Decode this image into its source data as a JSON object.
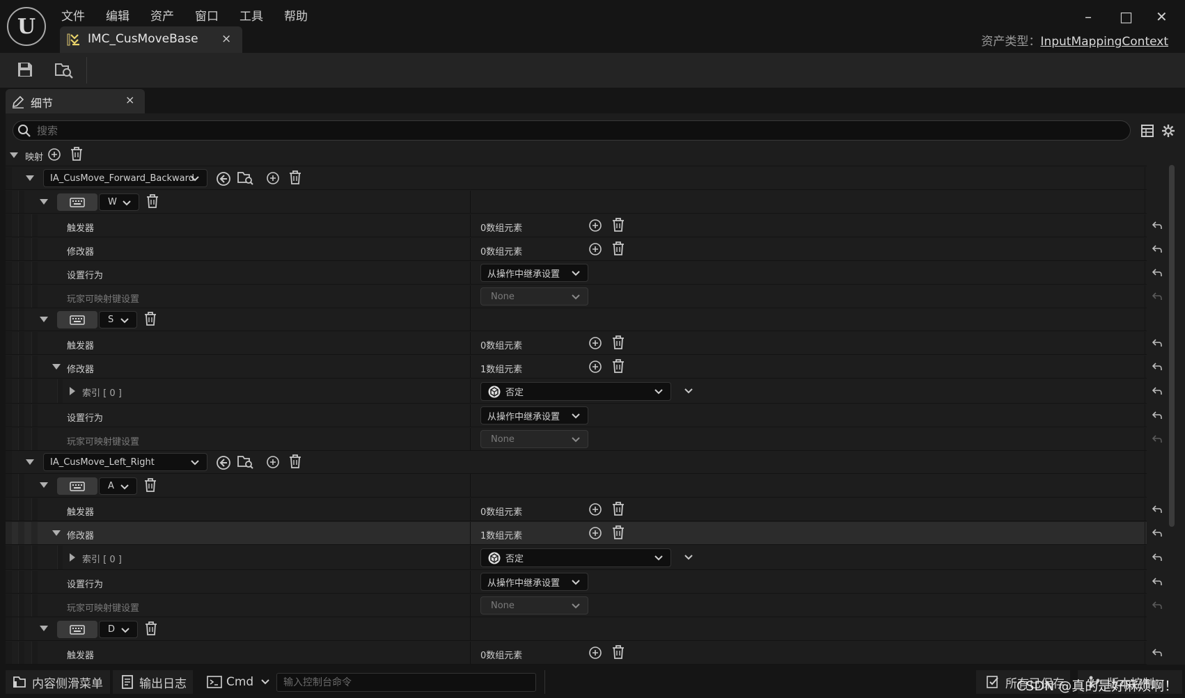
{
  "menu": [
    "文件",
    "编辑",
    "资产",
    "窗口",
    "工具",
    "帮助"
  ],
  "document_tab": {
    "title": "IMC_CusMoveBase",
    "close": "×"
  },
  "asset_type": {
    "label": "资产类型：",
    "value": "InputMappingContext"
  },
  "window_controls": {
    "minimize": "–",
    "maximize": "□",
    "close": "✕"
  },
  "panel_tab": {
    "title": "细节",
    "close": "×"
  },
  "search": {
    "placeholder": "搜索"
  },
  "mapping_header": {
    "label": "映射"
  },
  "actions": [
    {
      "name": "IA_CusMove_Forward_Backward"
    },
    {
      "name": "IA_CusMove_Left_Right"
    }
  ],
  "keys": {
    "w": "W",
    "s": "S",
    "a": "A",
    "d": "D"
  },
  "labels": {
    "triggers": "触发器",
    "modifiers": "修改器",
    "setting_behavior": "设置行为",
    "player_mappable": "玩家可映射键设置",
    "index0": "索引 [ 0 ]"
  },
  "values": {
    "zero_elements": "0数组元素",
    "one_element": "1数组元素",
    "inherit": "从操作中继承设置",
    "none": "None",
    "negate": "否定"
  },
  "statusbar": {
    "content_drawer": "内容侧滑菜单",
    "output_log": "输出日志",
    "cmd": "Cmd",
    "console_placeholder": "输入控制台命令",
    "saved": "所有已保存",
    "version_control": "版本控制",
    "watermark": "CSDN @真的是好麻烦啊！"
  }
}
